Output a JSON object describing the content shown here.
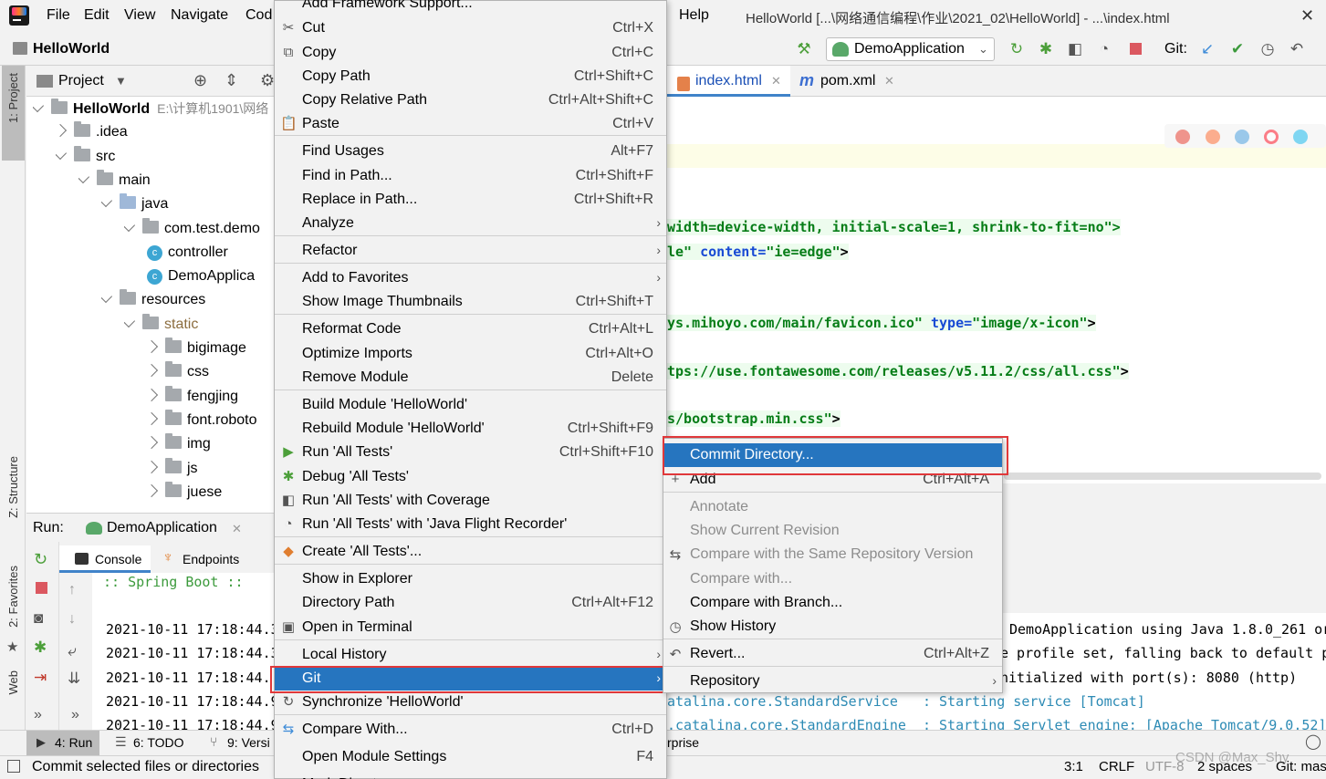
{
  "menubar": {
    "items": [
      "File",
      "Edit",
      "View",
      "Navigate",
      "Cod",
      "Help"
    ],
    "window_title": "HelloWorld [...\\网络通信编程\\作业\\2021_02\\HelloWorld] - ...\\index.html",
    "close_glyph": "✕"
  },
  "navbar": {
    "breadcrumb": "HelloWorld",
    "run_config": "DemoApplication",
    "git_label": "Git:"
  },
  "left_strip": {
    "project": "1: Project",
    "structure": "Z: Structure",
    "favorites": "2: Favorites",
    "web": "Web"
  },
  "project_panel": {
    "title": "Project",
    "tree": [
      {
        "label": "HelloWorld",
        "extra": "E:\\计算机1901\\网络",
        "indent": 0,
        "kind": "module",
        "open": true
      },
      {
        "label": ".idea",
        "indent": 1,
        "kind": "folder",
        "open": false
      },
      {
        "label": "src",
        "indent": 1,
        "kind": "folder",
        "open": true
      },
      {
        "label": "main",
        "indent": 2,
        "kind": "folder",
        "open": true
      },
      {
        "label": "java",
        "indent": 3,
        "kind": "src",
        "open": true
      },
      {
        "label": "com.test.demo",
        "indent": 4,
        "kind": "folder",
        "open": true
      },
      {
        "label": "controller",
        "indent": 5,
        "kind": "class"
      },
      {
        "label": "DemoApplica",
        "indent": 5,
        "kind": "class"
      },
      {
        "label": "resources",
        "indent": 3,
        "kind": "folder",
        "open": true
      },
      {
        "label": "static",
        "indent": 4,
        "kind": "folder",
        "open": true
      },
      {
        "label": "bigimage",
        "indent": 5,
        "kind": "folder",
        "open": false
      },
      {
        "label": "css",
        "indent": 5,
        "kind": "folder",
        "open": false
      },
      {
        "label": "fengjing",
        "indent": 5,
        "kind": "folder",
        "open": false
      },
      {
        "label": "font.roboto",
        "indent": 5,
        "kind": "folder",
        "open": false
      },
      {
        "label": "img",
        "indent": 5,
        "kind": "folder",
        "open": false
      },
      {
        "label": "js",
        "indent": 5,
        "kind": "folder",
        "open": false
      },
      {
        "label": "juese",
        "indent": 5,
        "kind": "folder",
        "open": false
      }
    ]
  },
  "editor": {
    "tabs": [
      {
        "label": "index.html"
      },
      {
        "label": "pom.xml"
      }
    ],
    "lines": [
      {
        "plain": "",
        "a1": "width=device-width, initial-scale=1, shrink-to-fit=no\">",
        "a2": "",
        "s1": "",
        "kind": "text"
      },
      {
        "plain": "le\"",
        "a1": " content=",
        "s1": "\"ie=edge\"",
        "tail": ">"
      },
      {
        "plain": "",
        "s1": "ys.mihoyo.com/main/favicon.ico\"",
        "a1": " type=",
        "s2": "\"image/x-icon\"",
        "tail": ">"
      },
      {
        "plain": "",
        "s1": "tps://use.fontawesome.com/releases/v5.11.2/css/all.css\"",
        "tail": ">"
      },
      {
        "plain": "",
        "s1": "s/bootstrap.min.css\"",
        "tail": ">"
      }
    ]
  },
  "run_panel": {
    "label": "Run:",
    "config": "DemoApplication",
    "tabs": [
      "Console",
      "Endpoints"
    ],
    "banner": " :: Spring Boot ::",
    "timestamps": [
      "2021-10-11 17:18:44.3",
      "2021-10-11 17:18:44.3",
      "2021-10-11 17:18:44.",
      "2021-10-11 17:18:44.9",
      "2021-10-11 17:18:44.9"
    ],
    "right_lines": [
      "DemoApplication using Java 1.8.0_261 or",
      "e profile set, falling back to default p",
      "nitialized with port(s): 8080 (http)",
      "atalina.core.StandardService   : Starting service [Tomcat]",
      ".catalina.core.StandardEngine  : Starting Servlet engine: [Apache Tomcat/9.0.52]"
    ]
  },
  "bottom_tabs": [
    "4: Run",
    "6: TODO",
    "9: Versi",
    "rprise"
  ],
  "status_bar": {
    "message": "Commit selected files or directories",
    "position": "3:1",
    "line_sep": "CRLF",
    "encoding": "UTF-8",
    "indent": "2 spaces",
    "git": "Git: mas",
    "watermark": "CSDN @Max_Shy"
  },
  "context_menu": {
    "items": [
      {
        "label": "Add Framework Support...",
        "shortcut": ""
      },
      {
        "label": "Cut",
        "shortcut": "Ctrl+X",
        "icon": "✂"
      },
      {
        "label": "Copy",
        "shortcut": "Ctrl+C",
        "icon": "⧉"
      },
      {
        "label": "Copy Path",
        "shortcut": "Ctrl+Shift+C"
      },
      {
        "label": "Copy Relative Path",
        "shortcut": "Ctrl+Alt+Shift+C"
      },
      {
        "label": "Paste",
        "shortcut": "Ctrl+V",
        "icon": "📋"
      },
      {
        "label": "Find Usages",
        "shortcut": "Alt+F7"
      },
      {
        "label": "Find in Path...",
        "shortcut": "Ctrl+Shift+F"
      },
      {
        "label": "Replace in Path...",
        "shortcut": "Ctrl+Shift+R"
      },
      {
        "label": "Analyze",
        "shortcut": "",
        "submenu": true
      },
      {
        "label": "Refactor",
        "shortcut": "",
        "submenu": true
      },
      {
        "label": "Add to Favorites",
        "shortcut": "",
        "submenu": true
      },
      {
        "label": "Show Image Thumbnails",
        "shortcut": "Ctrl+Shift+T"
      },
      {
        "label": "Reformat Code",
        "shortcut": "Ctrl+Alt+L"
      },
      {
        "label": "Optimize Imports",
        "shortcut": "Ctrl+Alt+O"
      },
      {
        "label": "Remove Module",
        "shortcut": "Delete"
      },
      {
        "label": "Build Module 'HelloWorld'",
        "shortcut": ""
      },
      {
        "label": "Rebuild Module 'HelloWorld'",
        "shortcut": "Ctrl+Shift+F9"
      },
      {
        "label": "Run 'All Tests'",
        "shortcut": "Ctrl+Shift+F10",
        "icon": "▶"
      },
      {
        "label": "Debug 'All Tests'",
        "shortcut": "",
        "icon": "✱"
      },
      {
        "label": "Run 'All Tests' with Coverage",
        "shortcut": "",
        "icon": "◧"
      },
      {
        "label": "Run 'All Tests' with 'Java Flight Recorder'",
        "shortcut": "",
        "icon": "◔"
      },
      {
        "label": "Create 'All Tests'...",
        "shortcut": "",
        "icon": "◆"
      },
      {
        "label": "Show in Explorer",
        "shortcut": ""
      },
      {
        "label": "Directory Path",
        "shortcut": "Ctrl+Alt+F12"
      },
      {
        "label": "Open in Terminal",
        "shortcut": "",
        "icon": "▣"
      },
      {
        "label": "Local History",
        "shortcut": "",
        "submenu": true
      },
      {
        "label": "Git",
        "shortcut": "",
        "submenu": true
      },
      {
        "label": "Synchronize 'HelloWorld'",
        "shortcut": "",
        "icon": "↻"
      },
      {
        "label": "Compare With...",
        "shortcut": "Ctrl+D",
        "icon": "⇆"
      },
      {
        "label": "Open Module Settings",
        "shortcut": "F4"
      },
      {
        "label": "Mark Directory as",
        "shortcut": "",
        "submenu": true
      }
    ]
  },
  "git_submenu": {
    "items": [
      {
        "label": "Commit Directory...",
        "shortcut": ""
      },
      {
        "label": "Add",
        "shortcut": "Ctrl+Alt+A",
        "icon": "+"
      },
      {
        "label": "Annotate",
        "shortcut": "",
        "disabled": true
      },
      {
        "label": "Show Current Revision",
        "shortcut": "",
        "disabled": true
      },
      {
        "label": "Compare with the Same Repository Version",
        "shortcut": "",
        "disabled": true,
        "icon": "⇆"
      },
      {
        "label": "Compare with...",
        "shortcut": "",
        "disabled": true
      },
      {
        "label": "Compare with Branch...",
        "shortcut": ""
      },
      {
        "label": "Show History",
        "shortcut": "",
        "icon": "◷"
      },
      {
        "label": "Revert...",
        "shortcut": "Ctrl+Alt+Z",
        "icon": "↶"
      },
      {
        "label": "Repository",
        "shortcut": "",
        "submenu": true
      }
    ]
  },
  "colors": {
    "selection": "#2675bf",
    "highlight_box": "#e0383a",
    "code_attr": "#174ad4",
    "code_string": "#067d17"
  }
}
